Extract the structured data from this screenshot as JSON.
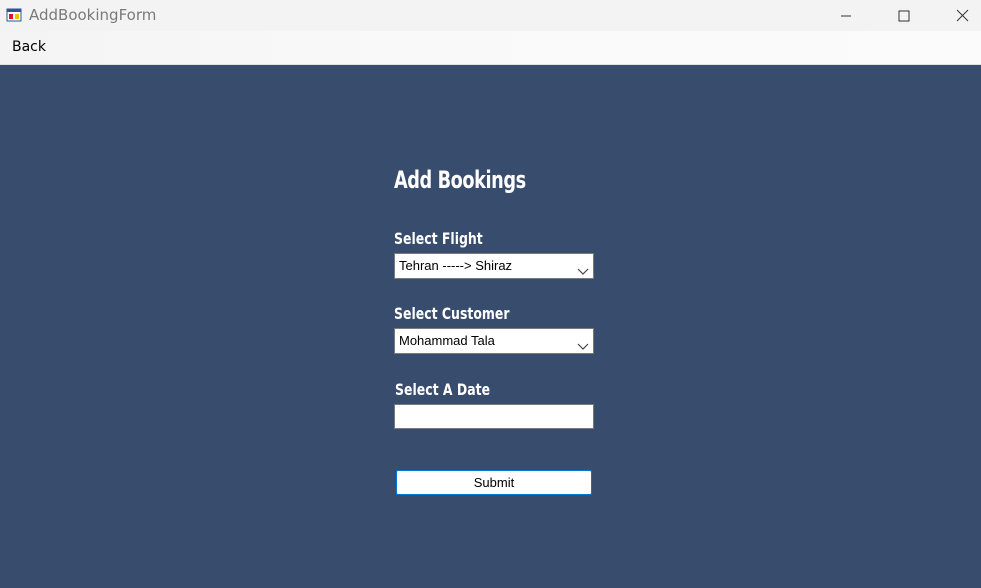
{
  "window": {
    "title": "AddBookingForm",
    "app_icon": "winforms-app-icon",
    "controls": {
      "minimize_icon": "minimize-icon",
      "maximize_icon": "maximize-icon",
      "close_icon": "close-icon"
    }
  },
  "menu": {
    "back_label": "Back"
  },
  "form": {
    "heading": "Add Bookings",
    "flight": {
      "label": "Select Flight",
      "selected": "Tehran -----> Shiraz"
    },
    "customer": {
      "label": "Select Customer",
      "selected": "Mohammad Tala"
    },
    "date": {
      "label": "Select A Date",
      "value": ""
    },
    "submit_label": "Submit"
  },
  "colors": {
    "form_background": "#384c6e",
    "titlebar_background": "#f3f3f3",
    "button_border": "#0078d7"
  }
}
